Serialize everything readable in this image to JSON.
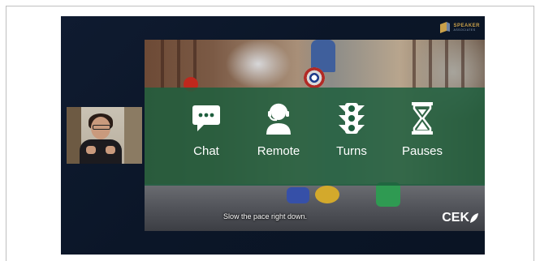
{
  "brand": {
    "name": "SPEAKER",
    "tagline": "ASSOCIATES"
  },
  "menu": {
    "items": [
      {
        "label": "Chat",
        "icon": "chat-bubble-icon"
      },
      {
        "label": "Remote",
        "icon": "headset-person-icon"
      },
      {
        "label": "Turns",
        "icon": "traffic-light-icon"
      },
      {
        "label": "Pauses",
        "icon": "hourglass-icon"
      }
    ]
  },
  "subtitle": {
    "text": "Slow the pace right down."
  },
  "logo": {
    "text": "CEK"
  },
  "colors": {
    "band": "#1e5e3e",
    "background": "#0b1628",
    "accent": "#c9a04a"
  }
}
